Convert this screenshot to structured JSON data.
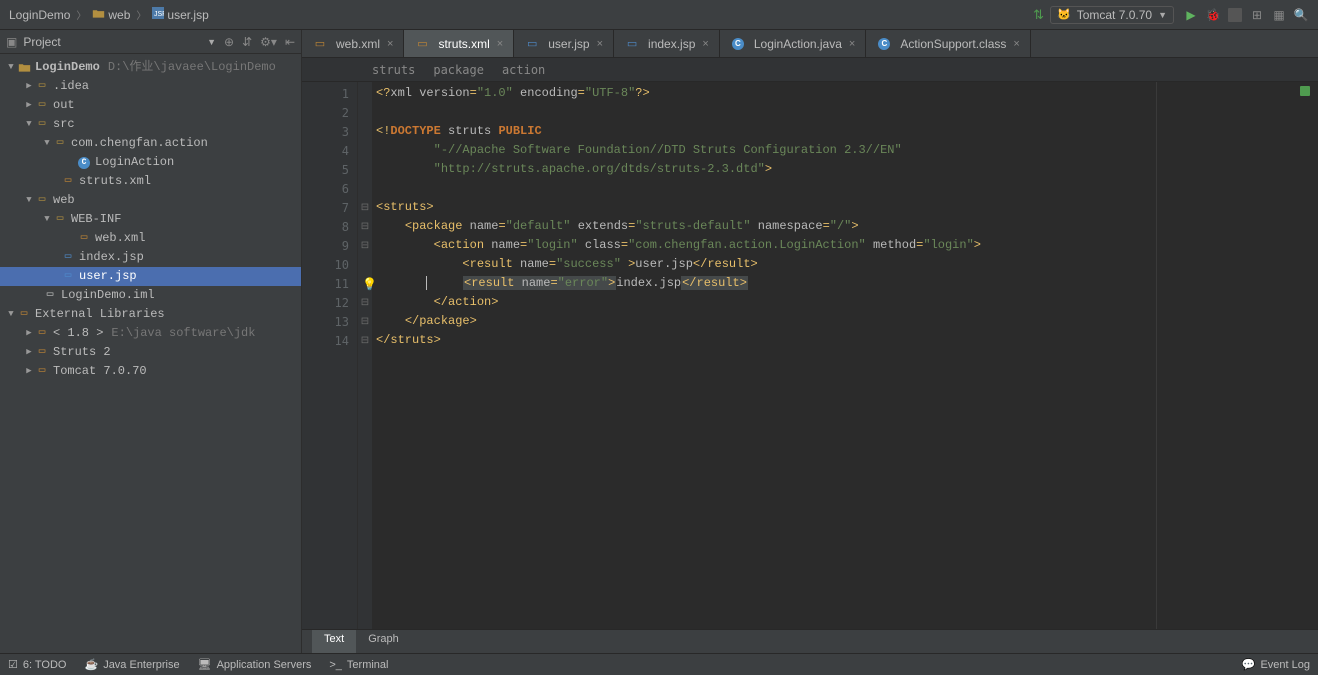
{
  "topbar": {
    "breadcrumbs": [
      "LoginDemo",
      "web",
      "user.jsp"
    ],
    "run_config": "Tomcat 7.0.70"
  },
  "sidebar": {
    "title": "Project"
  },
  "tree": {
    "project": "LoginDemo",
    "project_path": "D:\\作业\\javaee\\LoginDemo",
    "idea": ".idea",
    "out": "out",
    "src": "src",
    "pkg": "com.chengfan.action",
    "login_action": "LoginAction",
    "struts_xml": "struts.xml",
    "web": "web",
    "web_inf": "WEB-INF",
    "web_xml": "web.xml",
    "index_jsp": "index.jsp",
    "user_jsp": "user.jsp",
    "iml": "LoginDemo.iml",
    "ext_lib": "External Libraries",
    "jdk": "< 1.8 >",
    "jdk_path": "E:\\java software\\jdk",
    "struts2": "Struts 2",
    "tomcat": "Tomcat 7.0.70"
  },
  "tabs": [
    {
      "label": "web.xml",
      "closable": true
    },
    {
      "label": "struts.xml",
      "closable": true,
      "active": true
    },
    {
      "label": "user.jsp",
      "closable": true
    },
    {
      "label": "index.jsp",
      "closable": true
    },
    {
      "label": "LoginAction.java",
      "closable": true
    },
    {
      "label": "ActionSupport.class",
      "closable": true
    }
  ],
  "xml_path": [
    "struts",
    "package",
    "action"
  ],
  "code": {
    "line_count": 14,
    "xml_version": "1.0",
    "xml_encoding": "UTF-8",
    "doctype_root": "struts",
    "dtd_public": "-//Apache Software Foundation//DTD Struts Configuration 2.3//EN",
    "dtd_url": "http://struts.apache.org/dtds/struts-2.3.dtd",
    "pkg_name": "default",
    "pkg_extends": "struts-default",
    "pkg_ns": "/",
    "action_name": "login",
    "action_class": "com.chengfan.action.LoginAction",
    "action_method": "login",
    "result1_name": "success",
    "result1_body": "user.jsp",
    "result2_name": "error",
    "result2_body": "index.jsp"
  },
  "bottom_tabs": {
    "text": "Text",
    "graph": "Graph"
  },
  "statusbar": {
    "todo": "6: TODO",
    "java_ee": "Java Enterprise",
    "app_servers": "Application Servers",
    "terminal": "Terminal",
    "event_log": "Event Log"
  }
}
